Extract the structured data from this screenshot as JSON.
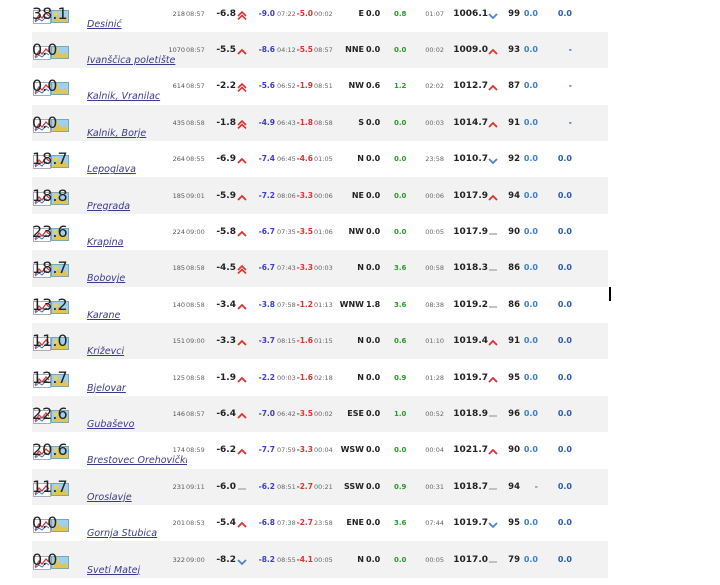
{
  "icons": {
    "chart": "chart-icon",
    "photo": "camera-photo-icon",
    "arrow_up": "arrow-up-icon",
    "arrow_double_up": "arrow-double-up-icon",
    "arrow_down": "arrow-down-icon",
    "arrow_flat": "dash-icon"
  },
  "colors": {
    "max_temp": "#dd3333",
    "min_temp": "#3b3bcf",
    "gust": "#2a9a2a",
    "rain": "#3a7fd0",
    "snow": "#8e3bb0",
    "arrow_up": "#e03030",
    "arrow_down": "#5080d0",
    "link": "#3a3a8c"
  },
  "stations": [
    {
      "name": "Desinić",
      "elev": "218",
      "t1": "08:57",
      "temp": "-6.8",
      "trend": "up2",
      "tmin": "-9.0",
      "t2": "07:22",
      "tmax": "-5.0",
      "t3": "00:02",
      "wdir": "E",
      "wspd": "0.0",
      "gust": "0.8",
      "t4": "01:07",
      "pres": "1006.1",
      "ptrend": "down",
      "hum": "99",
      "r1": "0.0",
      "r2": "0.0",
      "snow": "38.1"
    },
    {
      "name": "Ivanščica poletište",
      "elev": "1070",
      "t1": "08:57",
      "temp": "-5.5",
      "trend": "up",
      "tmin": "-8.6",
      "t2": "04:12",
      "tmax": "-5.5",
      "t3": "08:57",
      "wdir": "NNE",
      "wspd": "0.0",
      "gust": "0.0",
      "t4": "00:02",
      "pres": "1009.0",
      "ptrend": "up",
      "hum": "93",
      "r1": "0.0",
      "r2": "-",
      "snow": "0.0"
    },
    {
      "name": "Kalnik, Vranilac",
      "elev": "614",
      "t1": "08:57",
      "temp": "-2.2",
      "trend": "up2",
      "tmin": "-5.6",
      "t2": "06:52",
      "tmax": "-1.9",
      "t3": "08:51",
      "wdir": "NW",
      "wspd": "0.6",
      "gust": "1.2",
      "t4": "02:02",
      "pres": "1012.7",
      "ptrend": "up",
      "hum": "87",
      "r1": "0.0",
      "r2": "-",
      "snow": "0.0"
    },
    {
      "name": "Kalnik, Borje",
      "elev": "435",
      "t1": "08:58",
      "temp": "-1.8",
      "trend": "up2",
      "tmin": "-4.9",
      "t2": "06:43",
      "tmax": "-1.8",
      "t3": "08:58",
      "wdir": "S",
      "wspd": "0.0",
      "gust": "0.0",
      "t4": "00:03",
      "pres": "1014.7",
      "ptrend": "up",
      "hum": "91",
      "r1": "0.0",
      "r2": "-",
      "snow": "0.0"
    },
    {
      "name": "Lepoglava",
      "elev": "264",
      "t1": "08:55",
      "temp": "-6.9",
      "trend": "up",
      "tmin": "-7.4",
      "t2": "06:45",
      "tmax": "-4.6",
      "t3": "01:05",
      "wdir": "N",
      "wspd": "0.0",
      "gust": "0.0",
      "t4": "23:58",
      "pres": "1010.7",
      "ptrend": "down",
      "hum": "92",
      "r1": "0.0",
      "r2": "0.0",
      "snow": "18.7"
    },
    {
      "name": "Pregrada",
      "elev": "185",
      "t1": "09:01",
      "temp": "-5.9",
      "trend": "up",
      "tmin": "-7.2",
      "t2": "08:06",
      "tmax": "-3.3",
      "t3": "00:06",
      "wdir": "NE",
      "wspd": "0.0",
      "gust": "0.0",
      "t4": "00:06",
      "pres": "1017.9",
      "ptrend": "up",
      "hum": "94",
      "r1": "0.0",
      "r2": "0.0",
      "snow": "18.8"
    },
    {
      "name": "Krapina",
      "elev": "224",
      "t1": "09:00",
      "temp": "-5.8",
      "trend": "up",
      "tmin": "-6.7",
      "t2": "07:35",
      "tmax": "-3.5",
      "t3": "01:06",
      "wdir": "NW",
      "wspd": "0.0",
      "gust": "0.0",
      "t4": "00:05",
      "pres": "1017.9",
      "ptrend": "flat",
      "hum": "90",
      "r1": "0.0",
      "r2": "0.0",
      "snow": "23.6"
    },
    {
      "name": "Bobovje",
      "elev": "185",
      "t1": "08:58",
      "temp": "-4.5",
      "trend": "up2",
      "tmin": "-6.7",
      "t2": "07:43",
      "tmax": "-3.3",
      "t3": "00:03",
      "wdir": "N",
      "wspd": "0.0",
      "gust": "3.6",
      "t4": "00:58",
      "pres": "1018.3",
      "ptrend": "flat",
      "hum": "86",
      "r1": "0.0",
      "r2": "0.0",
      "snow": "18.7"
    },
    {
      "name": "Karane",
      "elev": "140",
      "t1": "08:58",
      "temp": "-3.4",
      "trend": "up",
      "tmin": "-3.8",
      "t2": "07:58",
      "tmax": "-1.2",
      "t3": "01:13",
      "wdir": "WNW",
      "wspd": "1.8",
      "gust": "3.6",
      "t4": "08:38",
      "pres": "1019.2",
      "ptrend": "flat",
      "hum": "86",
      "r1": "0.0",
      "r2": "0.0",
      "snow": "13.2"
    },
    {
      "name": "Križevci",
      "elev": "151",
      "t1": "09:00",
      "temp": "-3.3",
      "trend": "up",
      "tmin": "-3.7",
      "t2": "08:15",
      "tmax": "-1.6",
      "t3": "01:15",
      "wdir": "N",
      "wspd": "0.0",
      "gust": "0.6",
      "t4": "01:10",
      "pres": "1019.4",
      "ptrend": "up",
      "hum": "91",
      "r1": "0.0",
      "r2": "0.0",
      "snow": "11.0"
    },
    {
      "name": "Bjelovar",
      "elev": "125",
      "t1": "08:58",
      "temp": "-1.9",
      "trend": "up",
      "tmin": "-2.2",
      "t2": "00:03",
      "tmax": "-1.6",
      "t3": "02:18",
      "wdir": "N",
      "wspd": "0.0",
      "gust": "0.9",
      "t4": "01:28",
      "pres": "1019.7",
      "ptrend": "up",
      "hum": "95",
      "r1": "0.0",
      "r2": "0.0",
      "snow": "12.7"
    },
    {
      "name": "Gubaševo",
      "elev": "146",
      "t1": "08:57",
      "temp": "-6.4",
      "trend": "up",
      "tmin": "-7.0",
      "t2": "06:42",
      "tmax": "-3.5",
      "t3": "00:02",
      "wdir": "ESE",
      "wspd": "0.0",
      "gust": "1.0",
      "t4": "00:52",
      "pres": "1018.9",
      "ptrend": "flat",
      "hum": "96",
      "r1": "0.0",
      "r2": "0.0",
      "snow": "22.6"
    },
    {
      "name": "Brestovec Orehovički",
      "elev": "174",
      "t1": "08:59",
      "temp": "-6.2",
      "trend": "up",
      "tmin": "-7.7",
      "t2": "07:59",
      "tmax": "-3.3",
      "t3": "00:04",
      "wdir": "WSW",
      "wspd": "0.0",
      "gust": "0.0",
      "t4": "00:04",
      "pres": "1021.7",
      "ptrend": "up",
      "hum": "90",
      "r1": "0.0",
      "r2": "0.0",
      "snow": "20.6"
    },
    {
      "name": "Oroslavje",
      "elev": "231",
      "t1": "09:11",
      "temp": "-6.0",
      "trend": "flat",
      "tmin": "-6.2",
      "t2": "08:51",
      "tmax": "-2.7",
      "t3": "00:21",
      "wdir": "SSW",
      "wspd": "0.0",
      "gust": "0.9",
      "t4": "00:31",
      "pres": "1018.7",
      "ptrend": "flat",
      "hum": "94",
      "r1": "-",
      "r2": "0.0",
      "snow": "11.7"
    },
    {
      "name": "Gornja Stubica",
      "elev": "201",
      "t1": "08:53",
      "temp": "-5.4",
      "trend": "up",
      "tmin": "-6.8",
      "t2": "07:38",
      "tmax": "-2.7",
      "t3": "23:58",
      "wdir": "ENE",
      "wspd": "0.0",
      "gust": "3.6",
      "t4": "07:44",
      "pres": "1019.7",
      "ptrend": "down",
      "hum": "95",
      "r1": "0.0",
      "r2": "0.0",
      "snow": "0.0"
    },
    {
      "name": "Sveti Matej",
      "elev": "322",
      "t1": "09:00",
      "temp": "-8.2",
      "trend": "down",
      "tmin": "-8.2",
      "t2": "08:55",
      "tmax": "-4.1",
      "t3": "00:05",
      "wdir": "N",
      "wspd": "0.0",
      "gust": "0.0",
      "t4": "00:05",
      "pres": "1017.0",
      "ptrend": "flat",
      "hum": "79",
      "r1": "0.0",
      "r2": "0.0",
      "snow": "0.0"
    }
  ]
}
